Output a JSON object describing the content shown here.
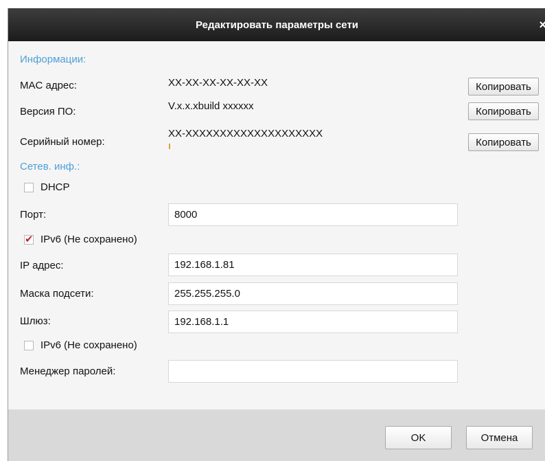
{
  "window": {
    "title": "Редактировать параметры сети",
    "close_glyph": "×"
  },
  "info": {
    "section_title": "Информации:",
    "mac_label": "MAC адрес:",
    "mac_value": "XX-XX-XX-XX-XX-XX",
    "firmware_label": "Версия ПО:",
    "firmware_value": "V.x.x.xbuild xxxxxx",
    "serial_label": "Серийный номер:",
    "serial_value": "XX-XXXXXXXXXXXXXXXXXXXX",
    "copy_label": "Копировать"
  },
  "network": {
    "section_title": "Сетев. инф.:",
    "dhcp_label": "DHCP",
    "dhcp_checked": false,
    "port_label": "Порт:",
    "port_value": "8000",
    "ipv6_label": "IPv6 (Не сохранено)",
    "ipv6_checked": true,
    "ip_label": "IP адрес:",
    "ip_value": "192.168.1.81",
    "mask_label": "Маска подсети:",
    "mask_value": "255.255.255.0",
    "gateway_label": "Шлюз:",
    "gateway_value": "192.168.1.1",
    "ipv6_second_label": "IPv6 (Не сохранено)",
    "ipv6_second_checked": false,
    "password_label": "Менеджер паролей:",
    "password_value": ""
  },
  "footer": {
    "ok_label": "OK",
    "cancel_label": "Отмена"
  },
  "colors": {
    "section": "#4f9fd8",
    "check": "#c1272d",
    "titlebar": "#2a2a2a"
  }
}
